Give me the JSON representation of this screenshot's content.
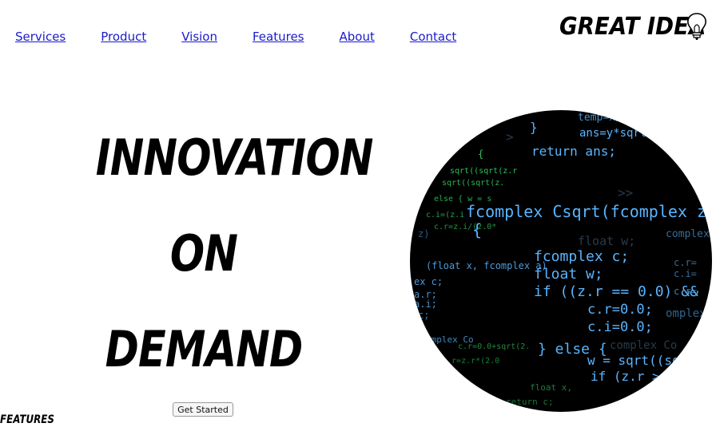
{
  "nav": {
    "items": [
      {
        "label": "Services"
      },
      {
        "label": "Product"
      },
      {
        "label": "Vision"
      },
      {
        "label": "Features"
      },
      {
        "label": "About"
      },
      {
        "label": "Contact"
      }
    ]
  },
  "brand": {
    "logo_text": "GREAT IDEA",
    "icon": "lightbulb-icon"
  },
  "hero": {
    "line1": "INNOVATION",
    "line2": "ON",
    "line3": "DEMAND",
    "cta_label": "Get Started",
    "image": "code-screenshot-image"
  },
  "sections": {
    "features_label": "FEATURES"
  },
  "colors": {
    "link": "#1a1acc",
    "code_bg": "#000000",
    "code_blue": "#5ab4ff",
    "code_green": "#36e06a"
  }
}
